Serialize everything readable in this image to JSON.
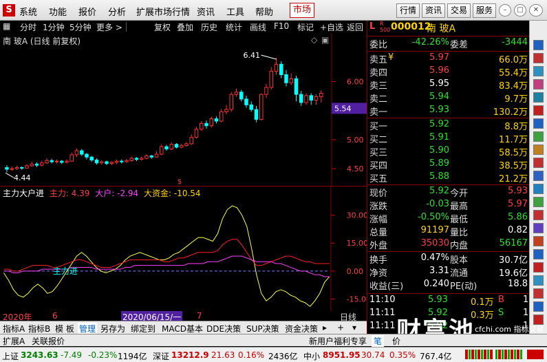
{
  "menu": {
    "logo": "S",
    "items": [
      "系统",
      "功能",
      "报价",
      "分析",
      "扩展市场行情",
      "资讯",
      "工具",
      "帮助"
    ],
    "market": "市场",
    "right_buttons": [
      "行情",
      "资讯",
      "交易",
      "服务"
    ]
  },
  "toolbar": {
    "items": [
      "分时",
      "1分钟",
      "5分钟",
      "更多 >",
      "复权",
      "叠加",
      "历史",
      "统计",
      "画线",
      "F10",
      "标记",
      "+自选",
      "返回"
    ]
  },
  "chart": {
    "stock_title": "南 玻A (日线 前复权)",
    "high_label": "6.41",
    "low_label": "4.44",
    "current_price_tag": "5.54",
    "y_ticks": [
      "6.00",
      "5.50",
      "5.00",
      "4.50"
    ],
    "indicator_name": "主力大户进",
    "ind_main_label": "主力: 4.39",
    "ind_big_label": "大户: -2.94",
    "ind_fund_label": "大资金: -10.54",
    "ind_ticks": [
      "30.00",
      "15.00",
      "0.00",
      "-15.00"
    ],
    "ind_annotation": "主力进",
    "date_left": "2020年",
    "date_m6": "6",
    "date_sel": "2020/06/15/一",
    "date_m7": "7",
    "period": "日线",
    "colors": {
      "up": "#ff3030",
      "down": "#00ffff",
      "yellow": "#ffff40",
      "magenta": "#ff40ff",
      "red_line": "#ff2020"
    }
  },
  "chart_data": {
    "type": "candlestick",
    "ylim": [
      4.3,
      6.6
    ],
    "candles": [
      [
        4.52,
        4.49,
        4.56,
        4.44
      ],
      [
        4.49,
        4.5,
        4.54,
        4.46
      ],
      [
        4.5,
        4.52,
        4.55,
        4.48
      ],
      [
        4.52,
        4.51,
        4.54,
        4.48
      ],
      [
        4.51,
        4.55,
        4.58,
        4.5
      ],
      [
        4.55,
        4.58,
        4.62,
        4.53
      ],
      [
        4.58,
        4.56,
        4.61,
        4.53
      ],
      [
        4.56,
        4.6,
        4.64,
        4.54
      ],
      [
        4.6,
        4.64,
        4.68,
        4.58
      ],
      [
        4.64,
        4.62,
        4.67,
        4.59
      ],
      [
        4.62,
        4.63,
        4.66,
        4.59
      ],
      [
        4.63,
        4.61,
        4.65,
        4.58
      ],
      [
        4.61,
        4.63,
        4.66,
        4.59
      ],
      [
        4.63,
        4.74,
        4.78,
        4.62
      ],
      [
        4.74,
        4.81,
        4.85,
        4.7
      ],
      [
        4.81,
        4.75,
        4.84,
        4.72
      ],
      [
        4.75,
        4.7,
        4.77,
        4.66
      ],
      [
        4.7,
        4.65,
        4.72,
        4.62
      ],
      [
        4.65,
        4.6,
        4.68,
        4.57
      ],
      [
        4.6,
        4.62,
        4.65,
        4.57
      ],
      [
        4.62,
        4.59,
        4.64,
        4.56
      ],
      [
        4.59,
        4.61,
        4.63,
        4.56
      ],
      [
        4.61,
        4.63,
        4.66,
        4.58
      ],
      [
        4.63,
        4.62,
        4.66,
        4.59
      ],
      [
        4.62,
        4.64,
        4.67,
        4.6
      ],
      [
        4.64,
        4.68,
        4.71,
        4.62
      ],
      [
        4.68,
        4.66,
        4.7,
        4.63
      ],
      [
        4.66,
        4.68,
        4.71,
        4.64
      ],
      [
        4.68,
        4.72,
        4.75,
        4.66
      ],
      [
        4.72,
        4.7,
        4.74,
        4.67
      ],
      [
        4.7,
        4.75,
        4.8,
        4.69
      ],
      [
        4.75,
        4.88,
        4.92,
        4.73
      ],
      [
        4.88,
        4.84,
        4.91,
        4.81
      ],
      [
        4.84,
        4.92,
        4.95,
        4.82
      ],
      [
        4.92,
        4.87,
        4.94,
        4.85
      ],
      [
        4.87,
        4.9,
        4.93,
        4.85
      ],
      [
        4.9,
        4.93,
        4.96,
        4.88
      ],
      [
        4.93,
        5.04,
        5.09,
        4.91
      ],
      [
        5.04,
        5.18,
        5.22,
        5.02
      ],
      [
        5.18,
        5.28,
        5.32,
        5.15
      ],
      [
        5.28,
        5.24,
        5.33,
        5.19
      ],
      [
        5.24,
        5.36,
        5.4,
        5.21
      ],
      [
        5.36,
        5.32,
        5.4,
        5.28
      ],
      [
        5.32,
        5.48,
        5.53,
        5.3
      ],
      [
        5.48,
        5.52,
        5.6,
        5.44
      ],
      [
        5.52,
        5.78,
        5.82,
        5.48
      ],
      [
        5.78,
        5.82,
        5.88,
        5.74
      ],
      [
        5.82,
        5.7,
        5.86,
        5.66
      ],
      [
        5.7,
        5.6,
        5.76,
        5.55
      ],
      [
        5.6,
        5.52,
        5.66,
        5.48
      ],
      [
        5.52,
        5.35,
        5.58,
        5.3
      ],
      [
        5.35,
        5.78,
        5.8,
        5.33
      ],
      [
        5.78,
        5.9,
        5.96,
        5.72
      ],
      [
        5.9,
        6.18,
        6.25,
        5.86
      ],
      [
        6.18,
        6.3,
        6.41,
        6.12
      ],
      [
        6.3,
        6.12,
        6.35,
        6.06
      ],
      [
        6.12,
        5.98,
        6.2,
        5.92
      ],
      [
        5.98,
        6.05,
        6.14,
        5.94
      ],
      [
        6.05,
        5.78,
        6.1,
        5.66
      ],
      [
        5.78,
        5.64,
        5.84,
        5.58
      ],
      [
        5.64,
        5.76,
        5.8,
        5.6
      ],
      [
        5.76,
        5.68,
        5.8,
        5.6
      ],
      [
        5.68,
        5.74,
        5.78,
        5.6
      ],
      [
        5.74,
        5.8,
        5.85,
        5.64
      ]
    ]
  },
  "indicator_data": {
    "ylim": [
      -20,
      38
    ],
    "yellow": [
      -1,
      -5,
      -10,
      -13,
      -14,
      -12,
      -9,
      -7,
      -9,
      -12,
      -11,
      -8,
      -4,
      0,
      4,
      8,
      10,
      8,
      5,
      2,
      0,
      -1,
      0,
      1,
      3,
      6,
      8,
      9,
      10,
      9,
      8,
      7,
      6,
      6,
      7,
      9,
      10,
      12,
      14,
      16,
      18,
      18,
      17,
      16,
      20,
      28,
      33,
      35,
      34,
      30,
      24,
      12,
      -2,
      -12,
      -16,
      -14,
      -11,
      -10,
      -11,
      -13,
      -14,
      -16,
      -17,
      -19,
      -16,
      -12,
      -6,
      -3
    ],
    "red": [
      1,
      1,
      0,
      0,
      1,
      2,
      3,
      3,
      3,
      3,
      2,
      2,
      3,
      4,
      5,
      6,
      6,
      5,
      4,
      3,
      2,
      2,
      2,
      3,
      4,
      5,
      6,
      6,
      6,
      6,
      6,
      6,
      6,
      5,
      5,
      6,
      7,
      7,
      8,
      9,
      10,
      10,
      10,
      10,
      11,
      14,
      16,
      17,
      17,
      14,
      10,
      6,
      3,
      3,
      4,
      5,
      6,
      7,
      8,
      8,
      7,
      6,
      5,
      5,
      4,
      4,
      4,
      4
    ],
    "magenta": [
      0,
      0,
      -1,
      -1,
      0,
      0,
      0,
      0,
      1,
      1,
      1,
      1,
      1,
      1,
      2,
      2,
      2,
      2,
      2,
      1,
      1,
      1,
      1,
      1,
      1,
      2,
      2,
      3,
      3,
      3,
      3,
      3,
      3,
      3,
      3,
      3,
      3,
      3,
      4,
      4,
      4,
      4,
      5,
      5,
      5,
      6,
      7,
      8,
      8,
      8,
      7,
      6,
      5,
      5,
      5,
      5,
      4,
      4,
      3,
      2,
      1,
      0,
      0,
      -1,
      -2,
      -2,
      -3,
      -3
    ]
  },
  "quote": {
    "code": "000012",
    "name": "南 玻A",
    "weibi_label": "委比",
    "weibi": "-42.26%",
    "weicha_label": "委差",
    "weicha": "-3444",
    "sells": [
      {
        "label": "卖五",
        "price": "5.97",
        "vol": "66.0万",
        "mark": "¥"
      },
      {
        "label": "卖四",
        "price": "5.96",
        "vol": "55.4万"
      },
      {
        "label": "卖三",
        "price": "5.95",
        "vol": "83.4万"
      },
      {
        "label": "卖二",
        "price": "5.94",
        "vol": "9.7万"
      },
      {
        "label": "卖一",
        "price": "5.93",
        "vol": "130.2万"
      }
    ],
    "buys": [
      {
        "label": "买一",
        "price": "5.92",
        "vol": "8.8万"
      },
      {
        "label": "买二",
        "price": "5.91",
        "vol": "11.7万"
      },
      {
        "label": "买三",
        "price": "5.90",
        "vol": "58.5万"
      },
      {
        "label": "买四",
        "price": "5.89",
        "vol": "38.5万"
      },
      {
        "label": "买五",
        "price": "5.88",
        "vol": "21.2万"
      }
    ],
    "stats": [
      {
        "l1": "现价",
        "v1": "5.92",
        "l2": "今开",
        "v2": "5.93"
      },
      {
        "l1": "涨跌",
        "v1": "-0.03",
        "l2": "最高",
        "v2": "5.97"
      },
      {
        "l1": "涨幅",
        "v1": "-0.50%",
        "l2": "最低",
        "v2": "5.86"
      },
      {
        "l1": "总量",
        "v1": "91197",
        "l2": "量比",
        "v2": "0.82"
      },
      {
        "l1": "外盘",
        "v1": "35030",
        "l2": "内盘",
        "v2": "56167"
      }
    ],
    "fin": [
      {
        "l1": "换手",
        "v1": "0.47%",
        "l2": "股本",
        "v2": "30.7亿"
      },
      {
        "l1": "净资",
        "v1": "3.31",
        "l2": "流通",
        "v2": "19.6亿"
      },
      {
        "l1": "收益(三)",
        "v1": "0.240",
        "l2": "PE(动)",
        "v2": "18.8"
      }
    ],
    "ticks": [
      {
        "time": "11:10",
        "price": "5.93",
        "vol": "0.1万",
        "bs": "B",
        "n": "1"
      },
      {
        "time": "11:11",
        "price": "5.92",
        "vol": "0.3万",
        "bs": "S",
        "n": "1"
      },
      {
        "time": "11:11",
        "price": "5.92",
        "vol": "",
        "bs": "",
        "n": "1"
      }
    ]
  },
  "tabs1": [
    "指标A",
    "指标B",
    "模 板",
    "管理",
    "另存为",
    "绑定到",
    "MACD基本",
    "DDE决策",
    "SUP决策",
    "资金决策"
  ],
  "tabs2": {
    "ext": "扩展A",
    "ref": "关联报价",
    "promo": "新用户福利专享",
    "pen": "笔",
    "price": "价"
  },
  "status": {
    "sh_label": "上证",
    "sh": "3243.63",
    "sh_chg": "-7.49",
    "sh_pct": "-0.23%",
    "sh_amt": "1194亿",
    "sz_label": "深证",
    "sz": "13212.9",
    "sz_chg": "21.63",
    "sz_pct": "0.16%",
    "sz_amt": "2436亿",
    "zx_label": "中小",
    "zx": "8951.95",
    "zx_chg": "30.74",
    "zx_pct": "0.35%",
    "zx_amt": "767.4亿"
  },
  "watermark": {
    "main": "财富池",
    "sub": "cfchi.com 指标交易平台"
  }
}
